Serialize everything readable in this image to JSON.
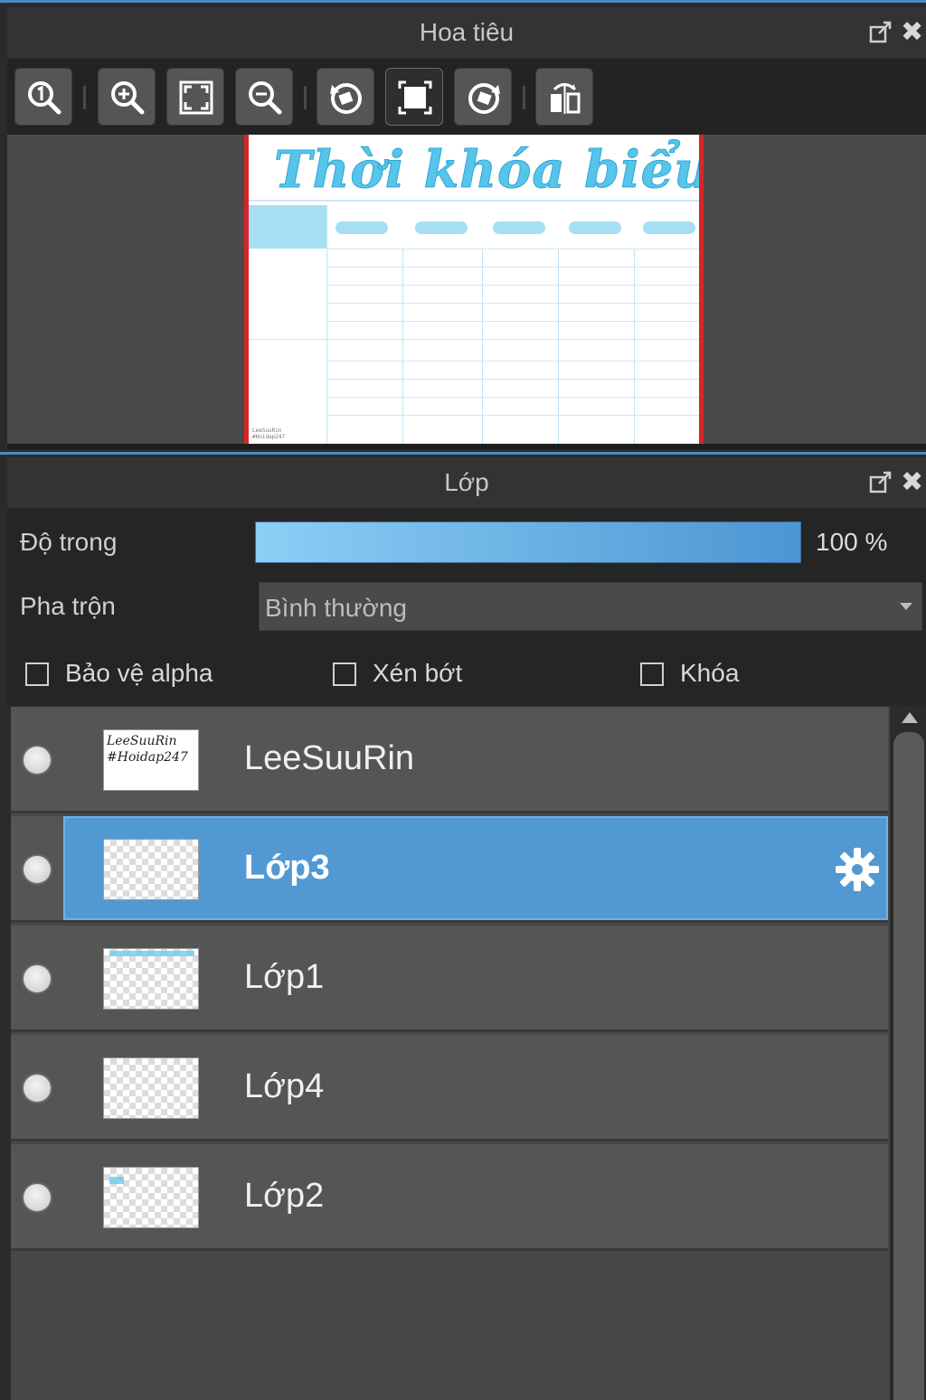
{
  "navigator": {
    "title": "Hoa tiêu",
    "toolbar": [
      {
        "name": "zoom-actual-icon"
      },
      {
        "name": "zoom-in-icon"
      },
      {
        "name": "fit-screen-icon"
      },
      {
        "name": "zoom-out-icon"
      },
      {
        "name": "rotate-left-icon"
      },
      {
        "name": "fit-frame-icon"
      },
      {
        "name": "rotate-right-icon"
      },
      {
        "name": "flip-icon"
      }
    ],
    "preview": {
      "title_text": "Thời khóa biểu",
      "signature": [
        "LeeSuuRin",
        "#Hoidap247"
      ],
      "accent_color": "#57c4ea",
      "border_color": "#d8262a"
    }
  },
  "layers": {
    "title": "Lớp",
    "opacity_label": "Độ trong",
    "opacity_value": "100 %",
    "opacity_fraction": 1.0,
    "blend_label": "Pha trộn",
    "blend_value": "Bình thường",
    "checkboxes": {
      "protect_alpha": "Bảo vệ alpha",
      "clip": "Xén bớt",
      "lock": "Khóa"
    },
    "items": [
      {
        "name": "LeeSuuRin",
        "thumb_text": [
          "LeeSuuRin",
          "#Hoidap247"
        ]
      },
      {
        "name": "Lớp3",
        "selected": true
      },
      {
        "name": "Lớp1"
      },
      {
        "name": "Lớp4"
      },
      {
        "name": "Lớp2"
      }
    ],
    "selection_color": "#5299d3"
  }
}
